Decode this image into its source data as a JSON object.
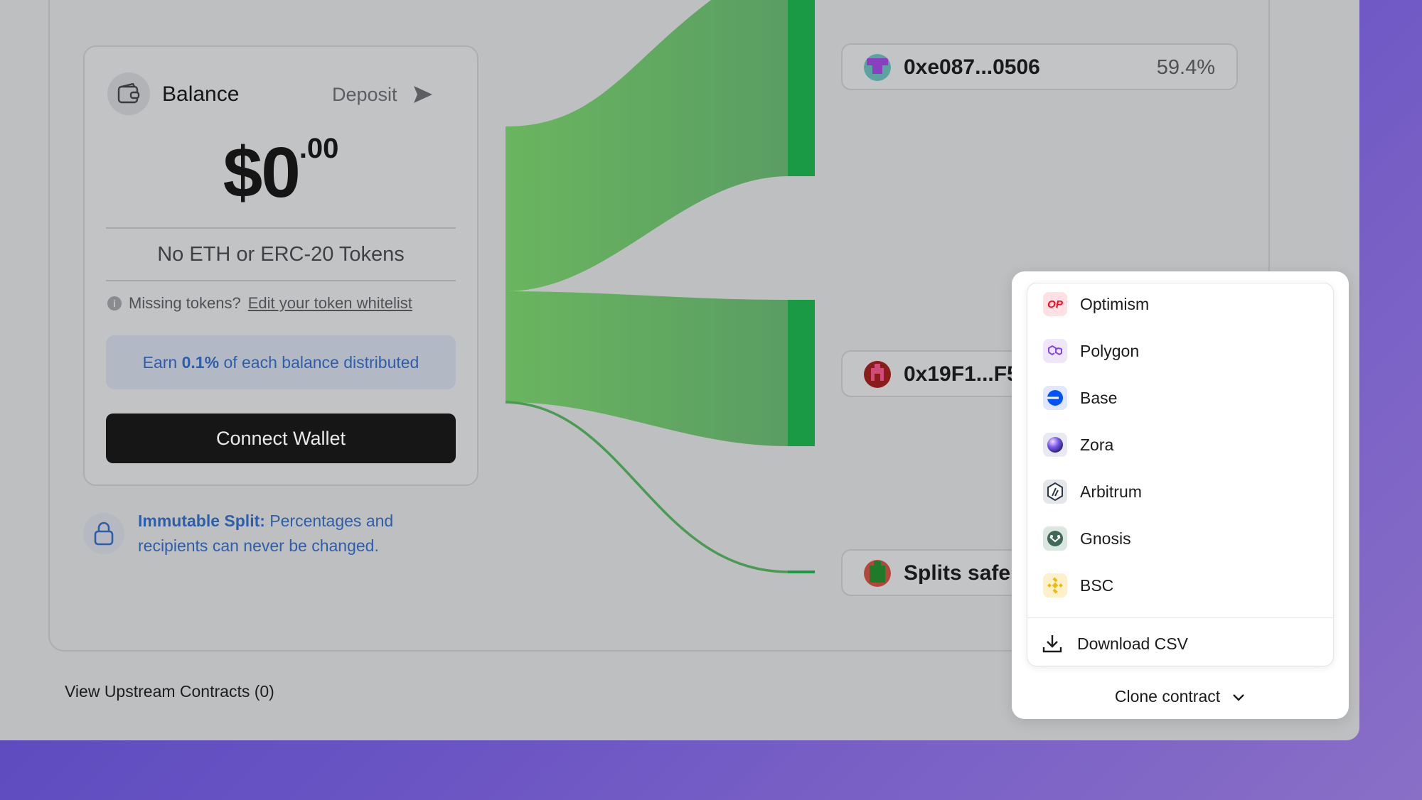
{
  "balance_card": {
    "title": "Balance",
    "deposit_label": "Deposit",
    "amount_main": "$0",
    "amount_cents": ".00",
    "no_tokens": "No ETH or ERC-20 Tokens",
    "missing_prefix": "Missing tokens?",
    "missing_link": "Edit your token whitelist",
    "earn_prefix": "Earn",
    "earn_rate": "0.1%",
    "earn_suffix": "of each balance distributed",
    "connect_label": "Connect Wallet"
  },
  "immutable_note": {
    "title": "Immutable Split:",
    "text": "Percentages and recipients can never be changed."
  },
  "recipients": [
    {
      "address": "0xe087...0506",
      "percent": "59.4%"
    },
    {
      "address": "0x19F1...F5C"
    },
    {
      "address": "Splits safe t"
    }
  ],
  "footer": {
    "upstream_label": "View Upstream Contracts (0)"
  },
  "clone_menu": {
    "items": [
      {
        "label": "Optimism",
        "icon": "optimism-icon",
        "color": "#ff0420"
      },
      {
        "label": "Polygon",
        "icon": "polygon-icon",
        "color": "#8247e5"
      },
      {
        "label": "Base",
        "icon": "base-icon",
        "color": "#0052ff"
      },
      {
        "label": "Zora",
        "icon": "zora-icon",
        "color": "#3b2fd1"
      },
      {
        "label": "Arbitrum",
        "icon": "arbitrum-icon",
        "color": "#2d374b"
      },
      {
        "label": "Gnosis",
        "icon": "gnosis-icon",
        "color": "#3e6957"
      },
      {
        "label": "BSC",
        "icon": "bsc-icon",
        "color": "#f0b90b"
      }
    ],
    "download_label": "Download CSV",
    "clone_label": "Clone contract"
  },
  "colors": {
    "flow_green": "#5aae5e",
    "node_green": "#1b9a45",
    "accent_blue": "#2f5ea8"
  }
}
